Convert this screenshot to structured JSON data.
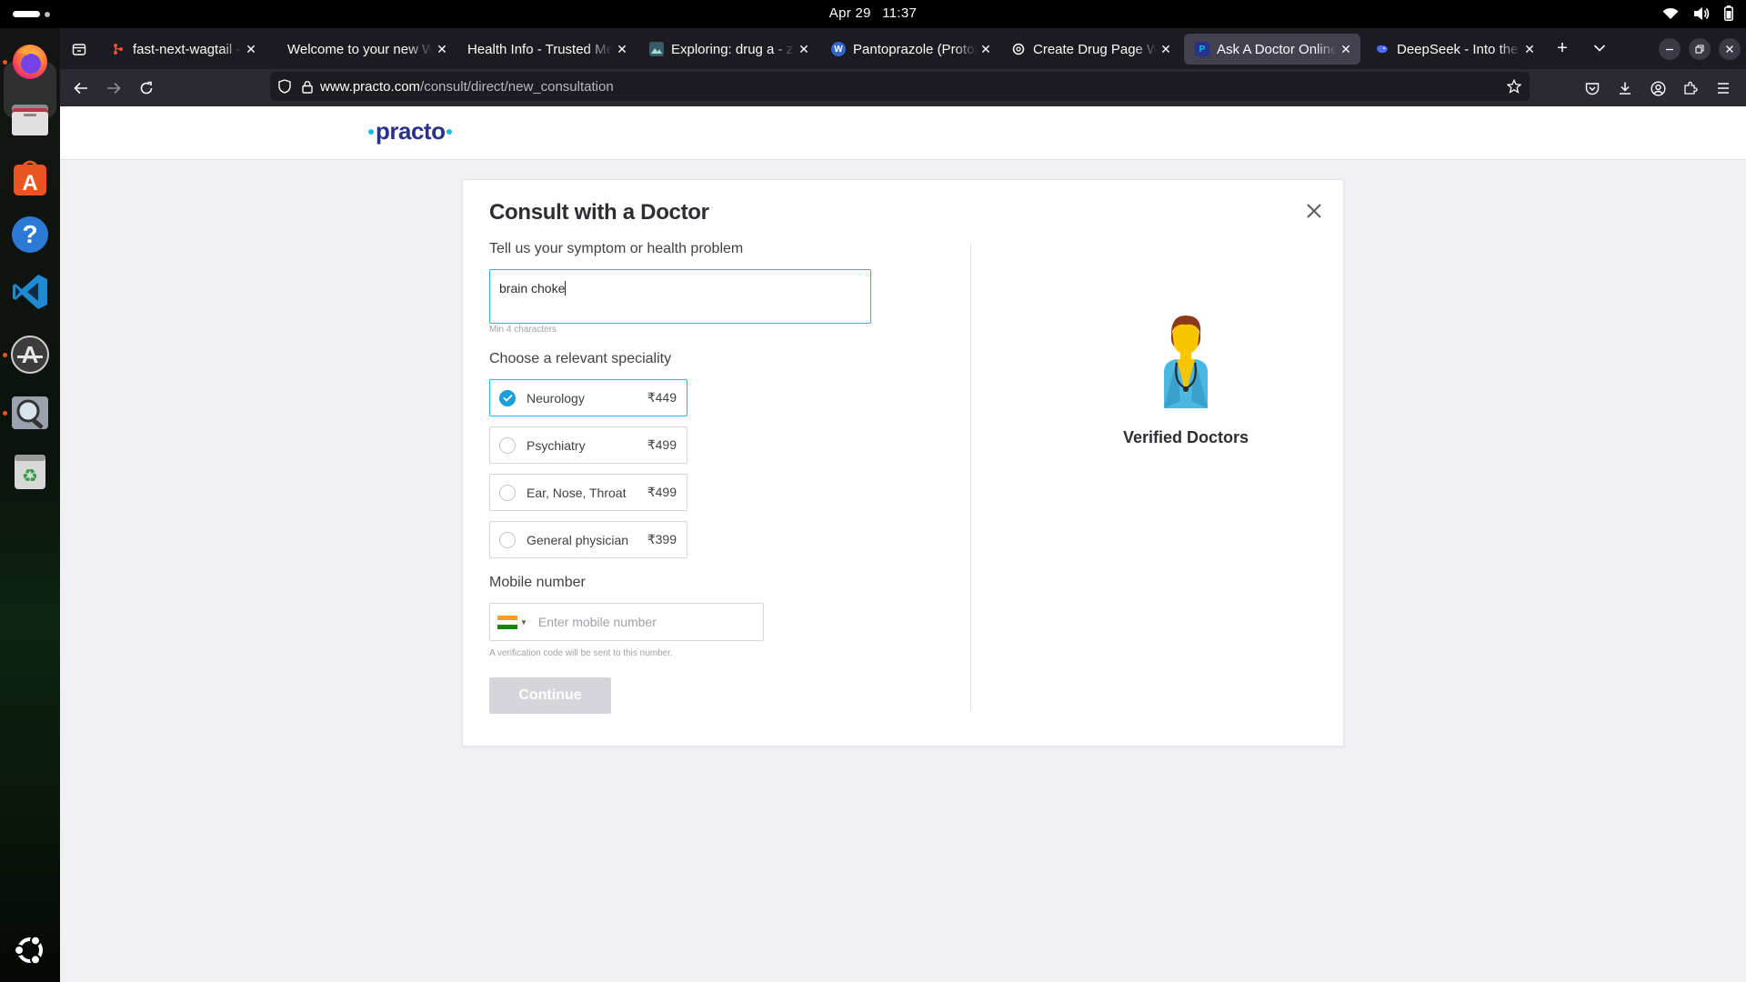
{
  "system": {
    "date": "Apr 29",
    "time": "11:37"
  },
  "dock": {
    "apps": [
      "firefox-icon",
      "files-icon",
      "app-center-icon",
      "help-icon",
      "vscode-icon",
      "software-updater-icon",
      "image-viewer-icon",
      "trash-icon",
      "ubuntu-logo-icon"
    ]
  },
  "browser": {
    "tabs": [
      {
        "title": "fast-next-wagtail - Re",
        "icon": "git-icon"
      },
      {
        "title": "Welcome to your new W",
        "icon": "none"
      },
      {
        "title": "Health Info - Trusted Me",
        "icon": "none"
      },
      {
        "title": "Exploring: drug a - z -",
        "icon": "image-icon"
      },
      {
        "title": "Pantoprazole (Proton",
        "icon": "wikipedia-icon"
      },
      {
        "title": "Create Drug Page Wa",
        "icon": "chatgpt-icon"
      },
      {
        "title": "Ask A Doctor Online A",
        "icon": "practo-icon"
      },
      {
        "title": "DeepSeek - Into the U",
        "icon": "deepseek-icon"
      }
    ],
    "active_tab": 6,
    "url_host": "www.practo.com",
    "url_path": "/consult/direct/new_consultation"
  },
  "site": {
    "logo_text": "practo"
  },
  "form": {
    "title": "Consult with a Doctor",
    "symptom_label": "Tell us your symptom or health problem",
    "symptom_value": "brain choke",
    "symptom_hint": "Min 4 characters",
    "speciality_label": "Choose a relevant speciality",
    "specialities": [
      {
        "name": "Neurology",
        "price": "₹449",
        "selected": true
      },
      {
        "name": "Psychiatry",
        "price": "₹499",
        "selected": false
      },
      {
        "name": "Ear, Nose, Throat",
        "price": "₹499",
        "selected": false
      },
      {
        "name": "General physician",
        "price": "₹399",
        "selected": false
      }
    ],
    "mobile_label": "Mobile number",
    "mobile_placeholder": "Enter mobile number",
    "mobile_hint": "A verification code will be sent to this number.",
    "continue_label": "Continue"
  },
  "side_panel": {
    "label": "Verified Doctors"
  },
  "colors": {
    "brand_cyan": "#14bef0",
    "brand_navy": "#28328c",
    "selected_check": "#199fd9",
    "button_disabled": "#d5d5db"
  }
}
